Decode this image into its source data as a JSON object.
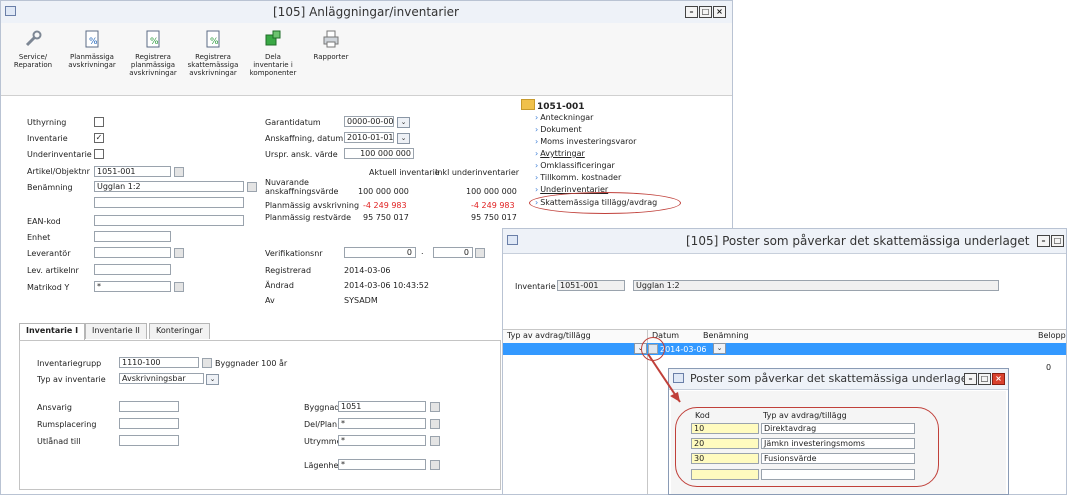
{
  "main_window": {
    "title": "[105]  Anläggningar/inventarier",
    "toolbar": [
      {
        "label_lines": [
          "Service/",
          "Reparation"
        ],
        "icon": "wrench-icon"
      },
      {
        "label_lines": [
          "Planmässiga",
          "avskrivningar"
        ],
        "icon": "document-percent-icon"
      },
      {
        "label_lines": [
          "Registrera",
          "planmässiga",
          "avskrivningar"
        ],
        "icon": "document-add-icon"
      },
      {
        "label_lines": [
          "Registrera",
          "skattemässiga",
          "avskrivningar"
        ],
        "icon": "document-tax-icon"
      },
      {
        "label_lines": [
          "Dela",
          "inventarie i",
          "komponenter"
        ],
        "icon": "split-components-icon"
      },
      {
        "label_lines": [
          "Rapporter"
        ],
        "icon": "printer-icon"
      }
    ],
    "left_form": {
      "uthyrning_label": "Uthyrning",
      "inventarie_label": "Inventarie",
      "underinventarie_label": "Underinventarie",
      "artikel_label": "Artikel/Objektnr",
      "artikel_value": "1051-001",
      "benamning_label": "Benämning",
      "benamning_value": "Ugglan 1:2",
      "ean_label": "EAN-kod",
      "enhet_label": "Enhet",
      "leverantor_label": "Leverantör",
      "lev_artikelnr_label": "Lev. artikelnr",
      "matrikelkod_label": "Matrikod Y",
      "matrikelkod_value": "*"
    },
    "middle_form": {
      "garantidatum_label": "Garantidatum",
      "garantidatum_value": "0000-00-00",
      "anskaffning_label": "Anskaffning, datum",
      "anskaffning_value": "2010-01-01",
      "urspr_label": "Urspr. ansk. värde",
      "urspr_value": "100 000 000",
      "col_aktuell": "Aktuell inventarie",
      "col_inkl": "Inkl underinventarier",
      "nuvarande_label": "Nuvarande",
      "anskaffningsvarde_label": "anskaffningsvärde",
      "anskaffningsvarde_a": "100 000 000",
      "anskaffningsvarde_b": "100 000 000",
      "planmassig_avskr_label": "Planmässig avskrivning",
      "planmassig_avskr_a": "-4 249 983",
      "planmassig_avskr_b": "-4 249 983",
      "planmassig_rest_label": "Planmässig restvärde",
      "planmassig_rest_a": "95 750 017",
      "planmassig_rest_b": "95 750 017",
      "verifikation_label": "Verifikationsnr",
      "verifikation_value": "0",
      "verifikation_sep": ".",
      "verifikation_value2": "0",
      "registrerad_label": "Registrerad",
      "registrerad_value": "2014-03-06",
      "andrad_label": "Ändrad",
      "andrad_value": "2014-03-06 10:43:52",
      "av_label": "Av",
      "av_value": "SYSADM"
    },
    "tree": {
      "root": "1051-001",
      "items": [
        "Anteckningar",
        "Dokument",
        "Moms investeringsvaror",
        "Avyttringar",
        "Omklassificeringar",
        "Tillkomm. kostnader",
        "Underinventarier",
        "Skattemässiga tillägg/avdrag"
      ]
    },
    "tabs": [
      "Inventarie I",
      "Inventarie II",
      "Konteringar"
    ],
    "tab_form": {
      "inventariegrupp_label": "Inventariegrupp",
      "inventariegrupp_value": "1110-100",
      "inventariegrupp_desc": "Byggnader 100 år",
      "typ_label": "Typ av inventarie",
      "typ_value": "Avskrivningsbar",
      "ansvarig_label": "Ansvarig",
      "rumsplacering_label": "Rumsplacering",
      "utlanad_label": "Utlånad till",
      "byggnad_label": "Byggnad",
      "byggnad_value": "1051",
      "delplan_label": "Del/Plan",
      "delplan_value": "*",
      "utrymme_label": "Utrymme",
      "utrymme_value": "*",
      "lagenhet_label": "Lägenhet",
      "lagenhet_value": "*"
    }
  },
  "second_window": {
    "title": "[105]  Poster som påverkar det skattemässiga underlaget",
    "inventarie_label": "Inventarie",
    "inventarie_value": "1051-001",
    "inventarie_desc": "Ugglan 1:2",
    "columns": [
      "Typ av avdrag/tillägg",
      "Datum",
      "Benämning",
      "Belopp"
    ],
    "row_date": "2014-03-06",
    "row_amount": "0"
  },
  "popup": {
    "title": "Poster som påverkar det skattemässiga underlaget",
    "col_kod": "Kod",
    "col_typ": "Typ av avdrag/tillägg",
    "rows": [
      {
        "kod": "10",
        "typ": "Direktavdrag"
      },
      {
        "kod": "20",
        "typ": "Jämkn investeringsmoms"
      },
      {
        "kod": "30",
        "typ": "Fusionsvärde"
      },
      {
        "kod": "",
        "typ": ""
      }
    ]
  },
  "colors": {
    "highlight_circle": "#c0403a",
    "selection_blue": "#3399ff",
    "negative_red": "#e02020"
  }
}
